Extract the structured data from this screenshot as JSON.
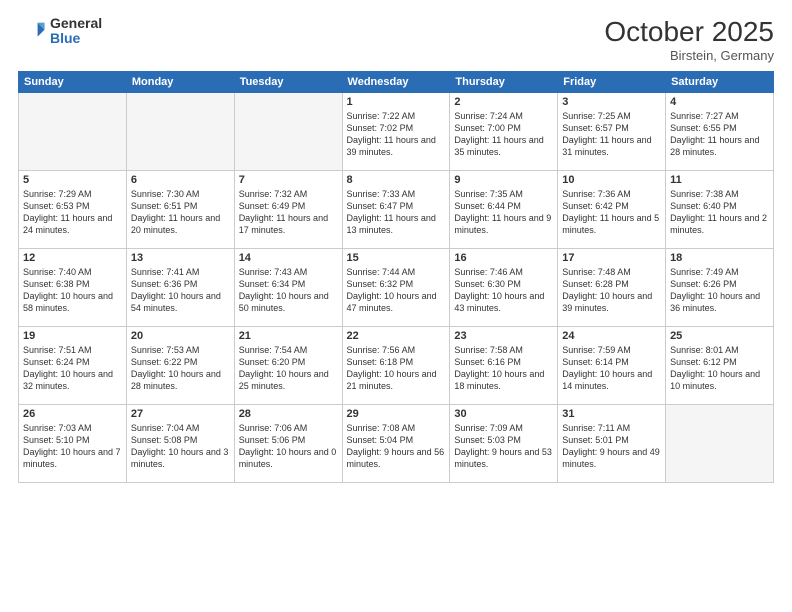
{
  "header": {
    "logo_general": "General",
    "logo_blue": "Blue",
    "month_title": "October 2025",
    "location": "Birstein, Germany"
  },
  "weekdays": [
    "Sunday",
    "Monday",
    "Tuesday",
    "Wednesday",
    "Thursday",
    "Friday",
    "Saturday"
  ],
  "weeks": [
    [
      {
        "day": "",
        "info": ""
      },
      {
        "day": "",
        "info": ""
      },
      {
        "day": "",
        "info": ""
      },
      {
        "day": "1",
        "info": "Sunrise: 7:22 AM\nSunset: 7:02 PM\nDaylight: 11 hours\nand 39 minutes."
      },
      {
        "day": "2",
        "info": "Sunrise: 7:24 AM\nSunset: 7:00 PM\nDaylight: 11 hours\nand 35 minutes."
      },
      {
        "day": "3",
        "info": "Sunrise: 7:25 AM\nSunset: 6:57 PM\nDaylight: 11 hours\nand 31 minutes."
      },
      {
        "day": "4",
        "info": "Sunrise: 7:27 AM\nSunset: 6:55 PM\nDaylight: 11 hours\nand 28 minutes."
      }
    ],
    [
      {
        "day": "5",
        "info": "Sunrise: 7:29 AM\nSunset: 6:53 PM\nDaylight: 11 hours\nand 24 minutes."
      },
      {
        "day": "6",
        "info": "Sunrise: 7:30 AM\nSunset: 6:51 PM\nDaylight: 11 hours\nand 20 minutes."
      },
      {
        "day": "7",
        "info": "Sunrise: 7:32 AM\nSunset: 6:49 PM\nDaylight: 11 hours\nand 17 minutes."
      },
      {
        "day": "8",
        "info": "Sunrise: 7:33 AM\nSunset: 6:47 PM\nDaylight: 11 hours\nand 13 minutes."
      },
      {
        "day": "9",
        "info": "Sunrise: 7:35 AM\nSunset: 6:44 PM\nDaylight: 11 hours\nand 9 minutes."
      },
      {
        "day": "10",
        "info": "Sunrise: 7:36 AM\nSunset: 6:42 PM\nDaylight: 11 hours\nand 5 minutes."
      },
      {
        "day": "11",
        "info": "Sunrise: 7:38 AM\nSunset: 6:40 PM\nDaylight: 11 hours\nand 2 minutes."
      }
    ],
    [
      {
        "day": "12",
        "info": "Sunrise: 7:40 AM\nSunset: 6:38 PM\nDaylight: 10 hours\nand 58 minutes."
      },
      {
        "day": "13",
        "info": "Sunrise: 7:41 AM\nSunset: 6:36 PM\nDaylight: 10 hours\nand 54 minutes."
      },
      {
        "day": "14",
        "info": "Sunrise: 7:43 AM\nSunset: 6:34 PM\nDaylight: 10 hours\nand 50 minutes."
      },
      {
        "day": "15",
        "info": "Sunrise: 7:44 AM\nSunset: 6:32 PM\nDaylight: 10 hours\nand 47 minutes."
      },
      {
        "day": "16",
        "info": "Sunrise: 7:46 AM\nSunset: 6:30 PM\nDaylight: 10 hours\nand 43 minutes."
      },
      {
        "day": "17",
        "info": "Sunrise: 7:48 AM\nSunset: 6:28 PM\nDaylight: 10 hours\nand 39 minutes."
      },
      {
        "day": "18",
        "info": "Sunrise: 7:49 AM\nSunset: 6:26 PM\nDaylight: 10 hours\nand 36 minutes."
      }
    ],
    [
      {
        "day": "19",
        "info": "Sunrise: 7:51 AM\nSunset: 6:24 PM\nDaylight: 10 hours\nand 32 minutes."
      },
      {
        "day": "20",
        "info": "Sunrise: 7:53 AM\nSunset: 6:22 PM\nDaylight: 10 hours\nand 28 minutes."
      },
      {
        "day": "21",
        "info": "Sunrise: 7:54 AM\nSunset: 6:20 PM\nDaylight: 10 hours\nand 25 minutes."
      },
      {
        "day": "22",
        "info": "Sunrise: 7:56 AM\nSunset: 6:18 PM\nDaylight: 10 hours\nand 21 minutes."
      },
      {
        "day": "23",
        "info": "Sunrise: 7:58 AM\nSunset: 6:16 PM\nDaylight: 10 hours\nand 18 minutes."
      },
      {
        "day": "24",
        "info": "Sunrise: 7:59 AM\nSunset: 6:14 PM\nDaylight: 10 hours\nand 14 minutes."
      },
      {
        "day": "25",
        "info": "Sunrise: 8:01 AM\nSunset: 6:12 PM\nDaylight: 10 hours\nand 10 minutes."
      }
    ],
    [
      {
        "day": "26",
        "info": "Sunrise: 7:03 AM\nSunset: 5:10 PM\nDaylight: 10 hours\nand 7 minutes."
      },
      {
        "day": "27",
        "info": "Sunrise: 7:04 AM\nSunset: 5:08 PM\nDaylight: 10 hours\nand 3 minutes."
      },
      {
        "day": "28",
        "info": "Sunrise: 7:06 AM\nSunset: 5:06 PM\nDaylight: 10 hours\nand 0 minutes."
      },
      {
        "day": "29",
        "info": "Sunrise: 7:08 AM\nSunset: 5:04 PM\nDaylight: 9 hours\nand 56 minutes."
      },
      {
        "day": "30",
        "info": "Sunrise: 7:09 AM\nSunset: 5:03 PM\nDaylight: 9 hours\nand 53 minutes."
      },
      {
        "day": "31",
        "info": "Sunrise: 7:11 AM\nSunset: 5:01 PM\nDaylight: 9 hours\nand 49 minutes."
      },
      {
        "day": "",
        "info": ""
      }
    ]
  ]
}
